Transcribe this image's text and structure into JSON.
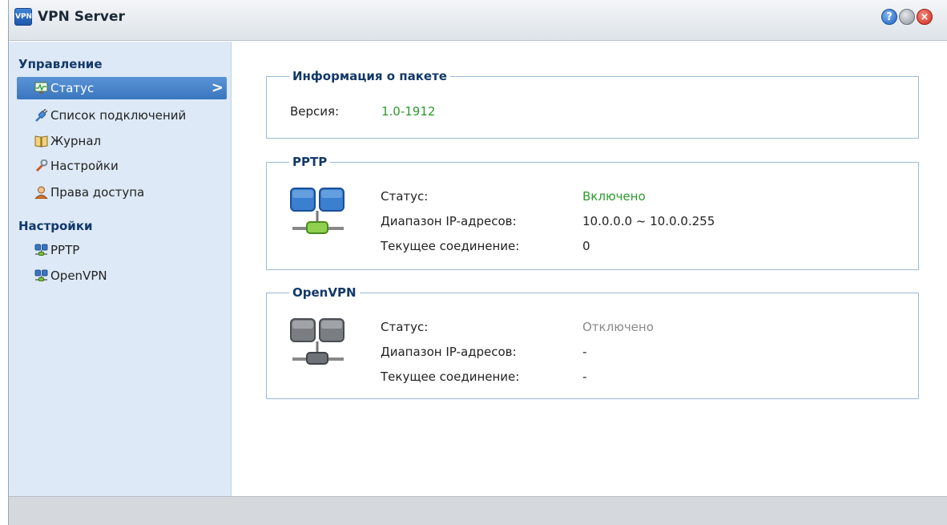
{
  "window": {
    "title": "VPN Server",
    "app_icon": "vpn-app-icon",
    "app_icon_text": "VPN",
    "controls": {
      "help": "?",
      "minimize": "",
      "close": "×"
    }
  },
  "sidebar": {
    "sections": [
      {
        "title": "Управление"
      },
      {
        "title": "Настройки"
      }
    ],
    "items": [
      {
        "label": "Статус",
        "icon": "monitor-icon",
        "active": true
      },
      {
        "label": "Список подключений",
        "icon": "plug-icon"
      },
      {
        "label": "Журнал",
        "icon": "book-icon"
      },
      {
        "label": "Настройки",
        "icon": "wrench-icon"
      },
      {
        "label": "Права доступа",
        "icon": "user-icon"
      },
      {
        "label": "PPTP",
        "icon": "network-icon"
      },
      {
        "label": "OpenVPN",
        "icon": "network-icon"
      }
    ],
    "active_chevron": ">"
  },
  "package_info": {
    "legend": "Информация о пакете",
    "version_label": "Версия:",
    "version_value": "1.0-1912"
  },
  "pptp": {
    "legend": "PPTP",
    "status_label": "Статус:",
    "status_value": "Включено",
    "range_label": "Диапазон IP-адресов:",
    "range_value": "10.0.0.0 ~ 10.0.0.255",
    "conn_label": "Текущее соединение:",
    "conn_value": "0"
  },
  "openvpn": {
    "legend": "OpenVPN",
    "status_label": "Статус:",
    "status_value": "Отключено",
    "range_label": "Диапазон IP-адресов:",
    "range_value": "-",
    "conn_label": "Текущее соединение:",
    "conn_value": "-"
  },
  "colors": {
    "accent": "#3a76c0",
    "enabled": "#2c9a2c",
    "disabled": "#8a8a8a",
    "section_title": "#12386a"
  }
}
